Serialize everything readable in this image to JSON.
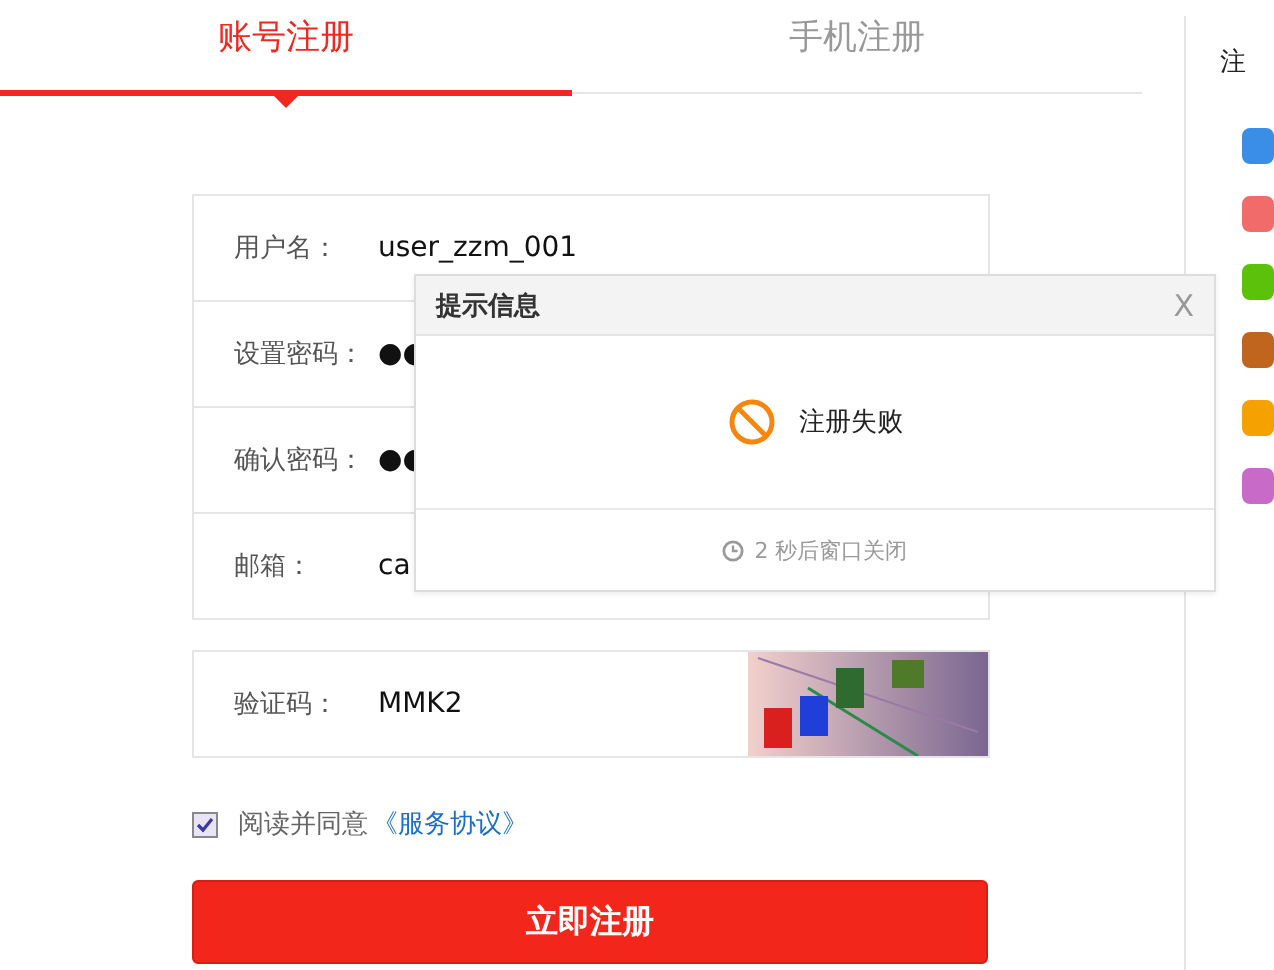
{
  "tabs": [
    {
      "label": "账号注册",
      "selected": true
    },
    {
      "label": "手机注册",
      "selected": false
    }
  ],
  "form": {
    "fields": [
      {
        "label": "用户名：",
        "value": "user_zzm_001"
      },
      {
        "label": "设置密码：",
        "value": "●●"
      },
      {
        "label": "确认密码：",
        "value": "●●"
      },
      {
        "label": "邮箱：",
        "value": "ca"
      }
    ],
    "captcha": {
      "label": "验证码：",
      "value": "MMK2"
    },
    "agreement": {
      "checked": true,
      "text": "阅读并同意",
      "link": "《服务协议》"
    },
    "submit": "立即注册"
  },
  "sidebar": {
    "title": "注",
    "icons": [
      {
        "color": "#3a8ee6"
      },
      {
        "color": "#f26b6b"
      },
      {
        "color": "#5cc10a"
      },
      {
        "color": "#c0651e"
      },
      {
        "color": "#f5a100"
      },
      {
        "color": "#c86ac8"
      }
    ]
  },
  "dialog": {
    "title": "提示信息",
    "close": "X",
    "message": "注册失败",
    "footer": "2 秒后窗口关闭"
  }
}
